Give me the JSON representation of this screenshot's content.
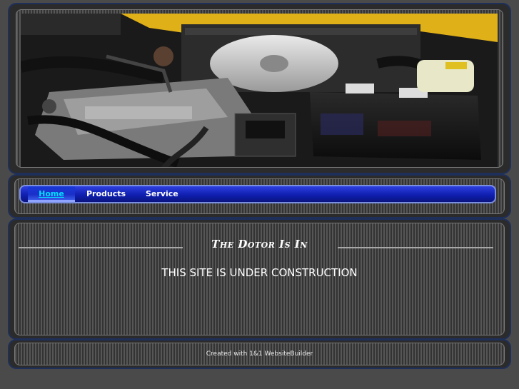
{
  "navigation": {
    "items": [
      {
        "label": "Home",
        "active": true
      },
      {
        "label": "Products",
        "active": false
      },
      {
        "label": "Service",
        "active": false
      }
    ]
  },
  "content": {
    "title": "The Dotor Is In",
    "message": "THIS SITE IS UNDER CONSTRUCTION"
  },
  "footer": {
    "credit": "Created with 1&1 WebsiteBuilder"
  },
  "colors": {
    "nav_blue": "#0f1fb0",
    "active_link": "#00e0ff",
    "frame_border": "#1e2f5a"
  }
}
